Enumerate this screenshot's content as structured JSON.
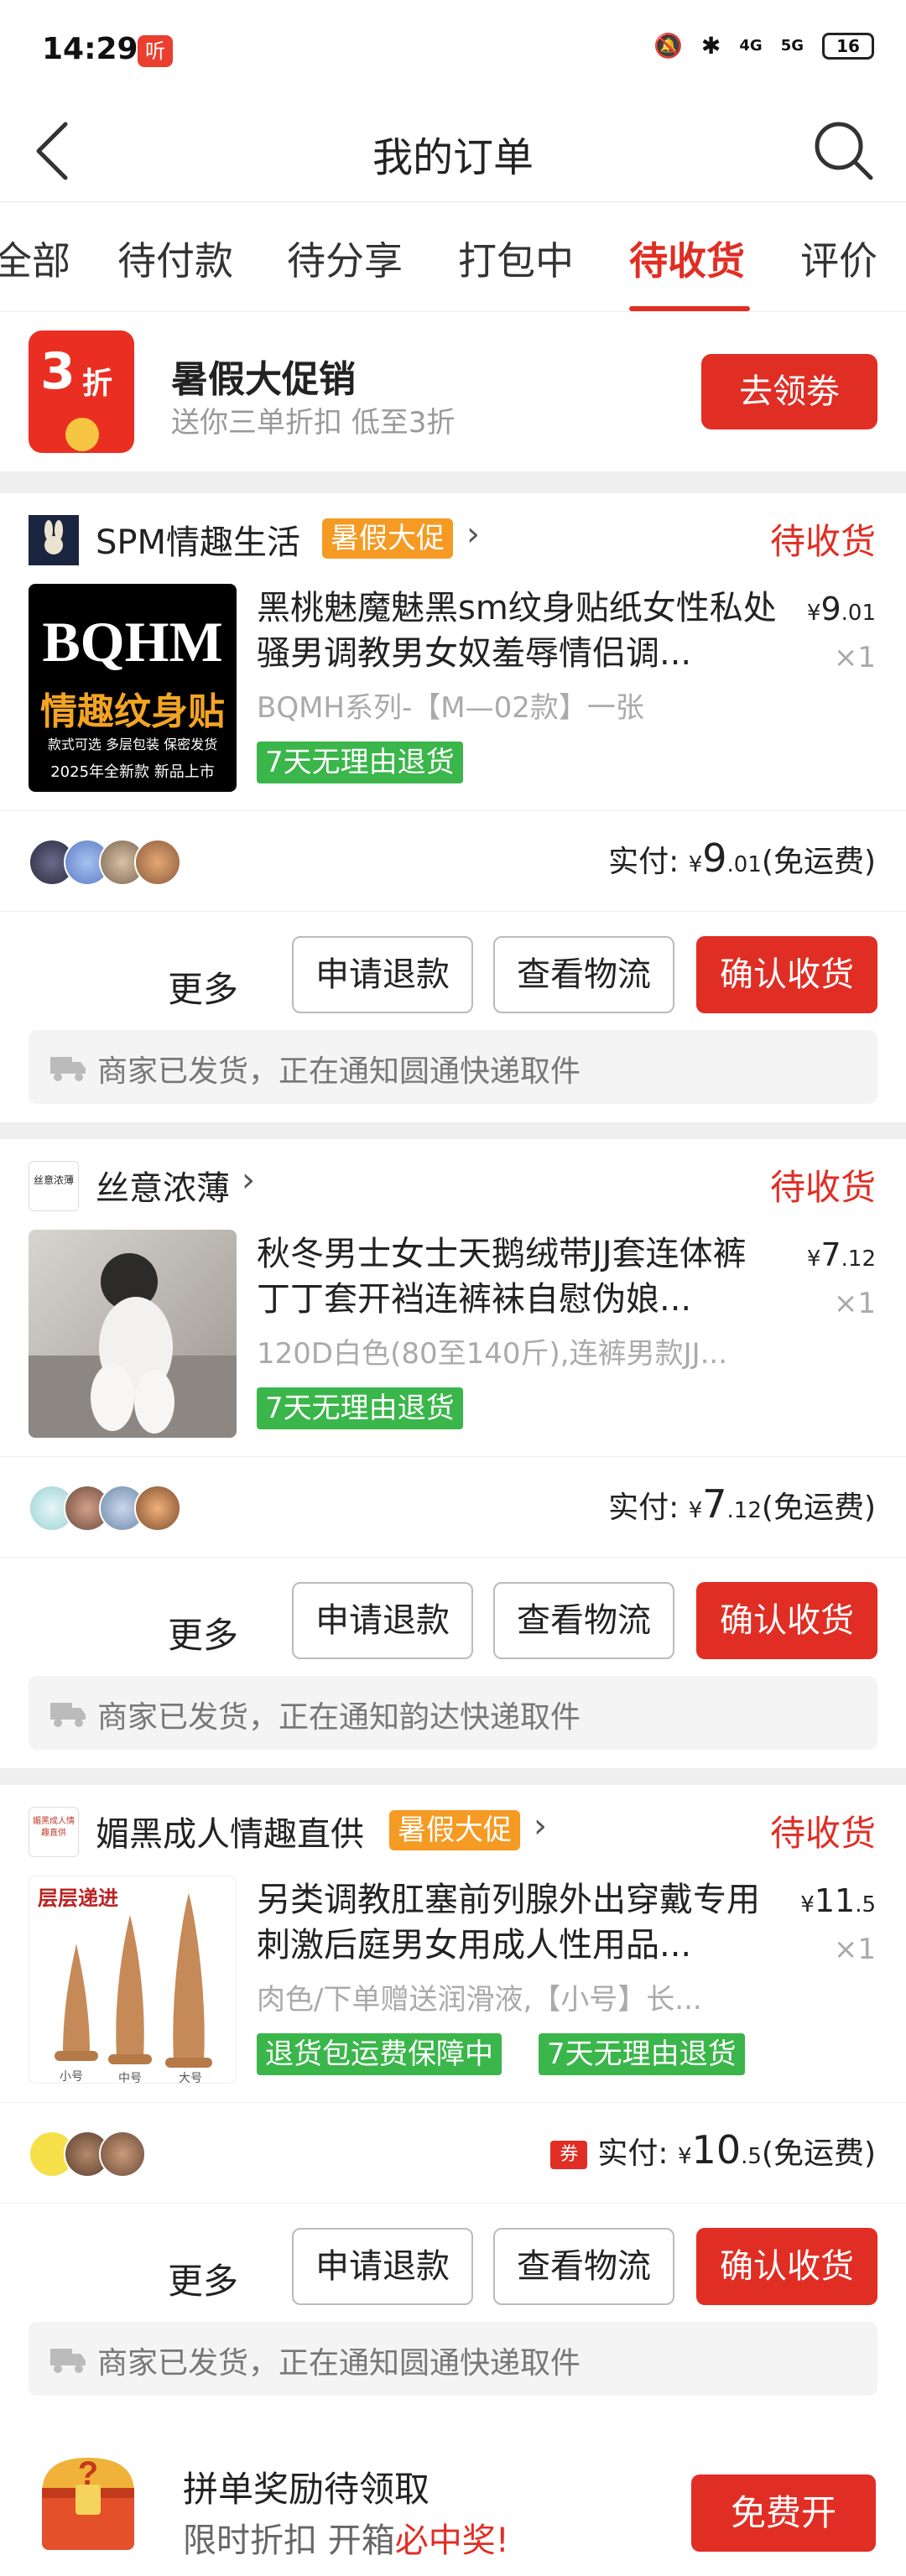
{
  "status_bar": {
    "time": "14:29",
    "app_badge": "听",
    "net1": "4G",
    "net2": "5G",
    "battery": "16"
  },
  "nav": {
    "title": "我的订单"
  },
  "tabs": [
    {
      "label": "全部"
    },
    {
      "label": "待付款"
    },
    {
      "label": "待分享"
    },
    {
      "label": "打包中"
    },
    {
      "label": "待收货"
    },
    {
      "label": "评价"
    }
  ],
  "promo": {
    "badge_num": "3",
    "badge_unit": "折",
    "title": "暑假大促销",
    "subtitle": "送你三单折扣 低至3折",
    "button": "去领劵"
  },
  "orders": [
    {
      "shop": "SPM情趣生活",
      "shop_tag": "暑假大促",
      "status": "待收货",
      "thumb_text1": "BQHM",
      "thumb_text2": "情趣纹身贴",
      "thumb_text3": "款式可选 多层包装 保密发货",
      "thumb_text4": "2025年全新款 新品上市",
      "name": "黑桃魅魔魅黑sm纹身贴纸女性私处骚男调教男女奴羞辱情侣调...",
      "spec": "BQMH系列-【M—02款】一张",
      "price_int": "9",
      "price_dec": ".01",
      "qty": "×1",
      "tags": [
        "7天无理由退货"
      ],
      "paid_label": "实付:",
      "paid_int": "9",
      "paid_dec": ".01",
      "paid_note": "(免运费)",
      "more": "更多",
      "btn_refund": "申请退款",
      "btn_logistics": "查看物流",
      "btn_confirm": "确认收货",
      "ship_msg": "商家已发货，正在通知圆通快递取件"
    },
    {
      "shop": "丝意浓薄",
      "status": "待收货",
      "shop_logo": "丝意浓薄",
      "name": "秋冬男士女士天鹅绒带JJ套连体裤丁丁套开裆连裤袜自慰伪娘...",
      "spec": "120D白色(80至140斤),连裤男款JJ...",
      "price_int": "7",
      "price_dec": ".12",
      "qty": "×1",
      "tags": [
        "7天无理由退货"
      ],
      "paid_label": "实付:",
      "paid_int": "7",
      "paid_dec": ".12",
      "paid_note": "(免运费)",
      "more": "更多",
      "btn_refund": "申请退款",
      "btn_logistics": "查看物流",
      "btn_confirm": "确认收货",
      "ship_msg": "商家已发货，正在通知韵达快递取件"
    },
    {
      "shop": "媚黑成人情趣直供",
      "shop_tag": "暑假大促",
      "status": "待收货",
      "shop_logo": "媚黑成人情趣直供",
      "thumb_title": "层层递进",
      "thumb_labels": [
        "小号",
        "中号",
        "大号"
      ],
      "name": "另类调教肛塞前列腺外出穿戴专用刺激后庭男女用成人性用品...",
      "spec": "肉色/下单赠送润滑液,【小号】长...",
      "price_int": "11",
      "price_dec": ".5",
      "qty": "×1",
      "tags": [
        "退货包运费保障中",
        "7天无理由退货"
      ],
      "coupon": "券",
      "paid_label": "实付:",
      "paid_int": "10",
      "paid_dec": ".5",
      "paid_note": "(免运费)",
      "more": "更多",
      "btn_refund": "申请退款",
      "btn_logistics": "查看物流",
      "btn_confirm": "确认收货",
      "ship_msg": "商家已发货，正在通知圆通快递取件"
    }
  ],
  "currency": "¥",
  "reward": {
    "title": "拼单奖励待领取",
    "sub_a": "限时折扣 开箱",
    "sub_b": "必中奖!",
    "button": "免费开"
  }
}
